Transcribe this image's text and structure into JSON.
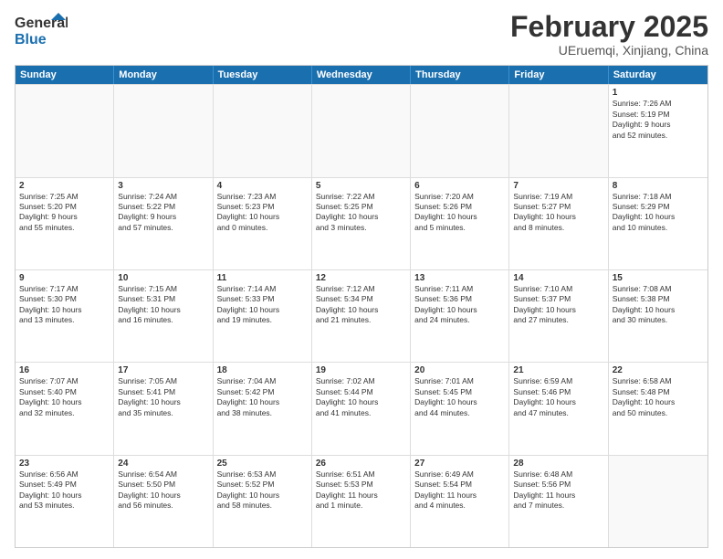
{
  "header": {
    "logo_general": "General",
    "logo_blue": "Blue",
    "title": "February 2025",
    "subtitle": "UEruemqi, Xinjiang, China"
  },
  "weekdays": [
    "Sunday",
    "Monday",
    "Tuesday",
    "Wednesday",
    "Thursday",
    "Friday",
    "Saturday"
  ],
  "rows": [
    [
      {
        "day": "",
        "info": ""
      },
      {
        "day": "",
        "info": ""
      },
      {
        "day": "",
        "info": ""
      },
      {
        "day": "",
        "info": ""
      },
      {
        "day": "",
        "info": ""
      },
      {
        "day": "",
        "info": ""
      },
      {
        "day": "1",
        "info": "Sunrise: 7:26 AM\nSunset: 5:19 PM\nDaylight: 9 hours\nand 52 minutes."
      }
    ],
    [
      {
        "day": "2",
        "info": "Sunrise: 7:25 AM\nSunset: 5:20 PM\nDaylight: 9 hours\nand 55 minutes."
      },
      {
        "day": "3",
        "info": "Sunrise: 7:24 AM\nSunset: 5:22 PM\nDaylight: 9 hours\nand 57 minutes."
      },
      {
        "day": "4",
        "info": "Sunrise: 7:23 AM\nSunset: 5:23 PM\nDaylight: 10 hours\nand 0 minutes."
      },
      {
        "day": "5",
        "info": "Sunrise: 7:22 AM\nSunset: 5:25 PM\nDaylight: 10 hours\nand 3 minutes."
      },
      {
        "day": "6",
        "info": "Sunrise: 7:20 AM\nSunset: 5:26 PM\nDaylight: 10 hours\nand 5 minutes."
      },
      {
        "day": "7",
        "info": "Sunrise: 7:19 AM\nSunset: 5:27 PM\nDaylight: 10 hours\nand 8 minutes."
      },
      {
        "day": "8",
        "info": "Sunrise: 7:18 AM\nSunset: 5:29 PM\nDaylight: 10 hours\nand 10 minutes."
      }
    ],
    [
      {
        "day": "9",
        "info": "Sunrise: 7:17 AM\nSunset: 5:30 PM\nDaylight: 10 hours\nand 13 minutes."
      },
      {
        "day": "10",
        "info": "Sunrise: 7:15 AM\nSunset: 5:31 PM\nDaylight: 10 hours\nand 16 minutes."
      },
      {
        "day": "11",
        "info": "Sunrise: 7:14 AM\nSunset: 5:33 PM\nDaylight: 10 hours\nand 19 minutes."
      },
      {
        "day": "12",
        "info": "Sunrise: 7:12 AM\nSunset: 5:34 PM\nDaylight: 10 hours\nand 21 minutes."
      },
      {
        "day": "13",
        "info": "Sunrise: 7:11 AM\nSunset: 5:36 PM\nDaylight: 10 hours\nand 24 minutes."
      },
      {
        "day": "14",
        "info": "Sunrise: 7:10 AM\nSunset: 5:37 PM\nDaylight: 10 hours\nand 27 minutes."
      },
      {
        "day": "15",
        "info": "Sunrise: 7:08 AM\nSunset: 5:38 PM\nDaylight: 10 hours\nand 30 minutes."
      }
    ],
    [
      {
        "day": "16",
        "info": "Sunrise: 7:07 AM\nSunset: 5:40 PM\nDaylight: 10 hours\nand 32 minutes."
      },
      {
        "day": "17",
        "info": "Sunrise: 7:05 AM\nSunset: 5:41 PM\nDaylight: 10 hours\nand 35 minutes."
      },
      {
        "day": "18",
        "info": "Sunrise: 7:04 AM\nSunset: 5:42 PM\nDaylight: 10 hours\nand 38 minutes."
      },
      {
        "day": "19",
        "info": "Sunrise: 7:02 AM\nSunset: 5:44 PM\nDaylight: 10 hours\nand 41 minutes."
      },
      {
        "day": "20",
        "info": "Sunrise: 7:01 AM\nSunset: 5:45 PM\nDaylight: 10 hours\nand 44 minutes."
      },
      {
        "day": "21",
        "info": "Sunrise: 6:59 AM\nSunset: 5:46 PM\nDaylight: 10 hours\nand 47 minutes."
      },
      {
        "day": "22",
        "info": "Sunrise: 6:58 AM\nSunset: 5:48 PM\nDaylight: 10 hours\nand 50 minutes."
      }
    ],
    [
      {
        "day": "23",
        "info": "Sunrise: 6:56 AM\nSunset: 5:49 PM\nDaylight: 10 hours\nand 53 minutes."
      },
      {
        "day": "24",
        "info": "Sunrise: 6:54 AM\nSunset: 5:50 PM\nDaylight: 10 hours\nand 56 minutes."
      },
      {
        "day": "25",
        "info": "Sunrise: 6:53 AM\nSunset: 5:52 PM\nDaylight: 10 hours\nand 58 minutes."
      },
      {
        "day": "26",
        "info": "Sunrise: 6:51 AM\nSunset: 5:53 PM\nDaylight: 11 hours\nand 1 minute."
      },
      {
        "day": "27",
        "info": "Sunrise: 6:49 AM\nSunset: 5:54 PM\nDaylight: 11 hours\nand 4 minutes."
      },
      {
        "day": "28",
        "info": "Sunrise: 6:48 AM\nSunset: 5:56 PM\nDaylight: 11 hours\nand 7 minutes."
      },
      {
        "day": "",
        "info": ""
      }
    ]
  ]
}
